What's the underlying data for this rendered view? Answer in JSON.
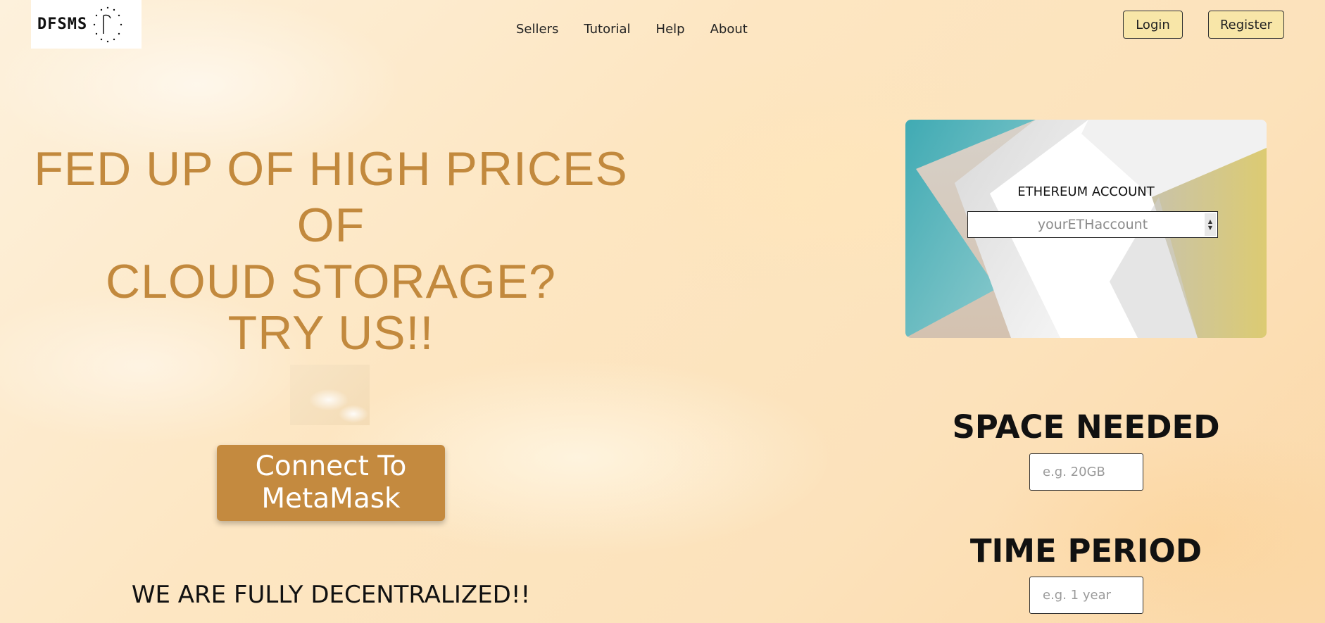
{
  "header": {
    "logo_text": "DFSMS",
    "nav": [
      "Sellers",
      "Tutorial",
      "Help",
      "About"
    ],
    "login_label": "Login",
    "register_label": "Register"
  },
  "hero": {
    "line1": "FED UP OF HIGH PRICES OF",
    "line2": "CLOUD STORAGE?",
    "cta_text": "TRY US!!",
    "connect_line1": "Connect To",
    "connect_line2": "MetaMask",
    "tagline": "WE ARE FULLY DECENTRALIZED!!"
  },
  "form": {
    "eth_label": "ETHEREUM ACCOUNT",
    "eth_placeholder": "yourETHaccount",
    "space_title": "SPACE NEEDED",
    "space_placeholder": "e.g. 20GB",
    "time_title": "TIME PERIOD",
    "time_placeholder": "e.g. 1 year"
  },
  "colors": {
    "accent": "#c48a3f",
    "headline": "#c2893d",
    "auth_button_bg": "#f8e6a8"
  }
}
